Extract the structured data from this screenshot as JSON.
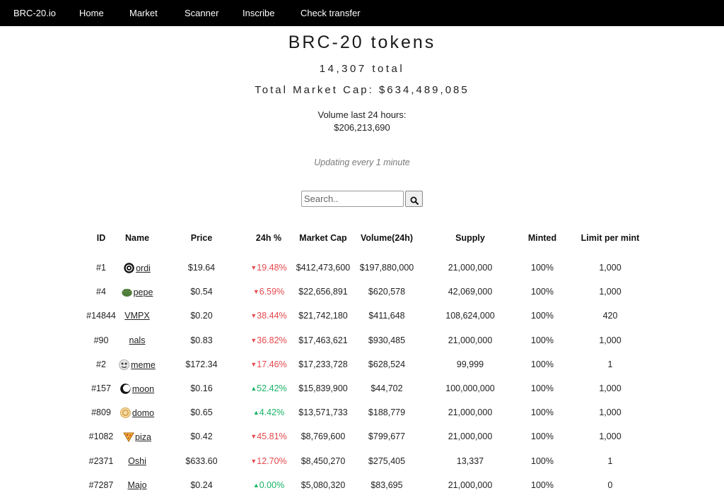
{
  "nav": {
    "brand": "BRC-20.io",
    "items": [
      "Home",
      "Market",
      "Scanner",
      "Inscribe",
      "Check transfer"
    ]
  },
  "header": {
    "title": "BRC-20 tokens",
    "total": "14,307 total",
    "market_cap": "Total Market Cap: $634,489,085",
    "volume_label": "Volume last 24 hours:",
    "volume_value": "$206,213,690",
    "updating": "Updating every 1 minute"
  },
  "search": {
    "placeholder": "Search..",
    "button_icon": "search-icon"
  },
  "colors": {
    "navbar_bg": "#000000",
    "negative": "#e5484d",
    "positive": "#16b364"
  },
  "table": {
    "columns": [
      "ID",
      "Name",
      "Price",
      "24h %",
      "Market Cap",
      "Volume(24h)",
      "Supply",
      "Minted",
      "Limit per mint"
    ],
    "rows": [
      {
        "id": "#1",
        "name": "ordi",
        "icon": "ordi-icon",
        "price": "$19.64",
        "change": "19.48%",
        "dir": "down",
        "mcap": "$412,473,600",
        "volume": "$197,880,000",
        "supply": "21,000,000",
        "minted": "100%",
        "limit": "1,000"
      },
      {
        "id": "#4",
        "name": "pepe",
        "icon": "pepe-icon",
        "price": "$0.54",
        "change": "6.59%",
        "dir": "down",
        "mcap": "$22,656,891",
        "volume": "$620,578",
        "supply": "42,069,000",
        "minted": "100%",
        "limit": "1,000"
      },
      {
        "id": "#14844",
        "name": "VMPX",
        "icon": "",
        "price": "$0.20",
        "change": "38.44%",
        "dir": "down",
        "mcap": "$21,742,180",
        "volume": "$411,648",
        "supply": "108,624,000",
        "minted": "100%",
        "limit": "420"
      },
      {
        "id": "#90",
        "name": "nals",
        "icon": "",
        "price": "$0.83",
        "change": "36.82%",
        "dir": "down",
        "mcap": "$17,463,621",
        "volume": "$930,485",
        "supply": "21,000,000",
        "minted": "100%",
        "limit": "1,000"
      },
      {
        "id": "#2",
        "name": "meme",
        "icon": "meme-icon",
        "price": "$172.34",
        "change": "17.46%",
        "dir": "down",
        "mcap": "$17,233,728",
        "volume": "$628,524",
        "supply": "99,999",
        "minted": "100%",
        "limit": "1"
      },
      {
        "id": "#157",
        "name": "moon",
        "icon": "moon-icon",
        "price": "$0.16",
        "change": "52.42%",
        "dir": "up",
        "mcap": "$15,839,900",
        "volume": "$44,702",
        "supply": "100,000,000",
        "minted": "100%",
        "limit": "1,000"
      },
      {
        "id": "#809",
        "name": "domo",
        "icon": "domo-icon",
        "price": "$0.65",
        "change": "4.42%",
        "dir": "up",
        "mcap": "$13,571,733",
        "volume": "$188,779",
        "supply": "21,000,000",
        "minted": "100%",
        "limit": "1,000"
      },
      {
        "id": "#1082",
        "name": "piza",
        "icon": "pizza-icon",
        "price": "$0.42",
        "change": "45.81%",
        "dir": "down",
        "mcap": "$8,769,600",
        "volume": "$799,677",
        "supply": "21,000,000",
        "minted": "100%",
        "limit": "1,000"
      },
      {
        "id": "#2371",
        "name": "Oshi",
        "icon": "",
        "price": "$633.60",
        "change": "12.70%",
        "dir": "down",
        "mcap": "$8,450,270",
        "volume": "$275,405",
        "supply": "13,337",
        "minted": "100%",
        "limit": "1"
      },
      {
        "id": "#7287",
        "name": "Majo",
        "icon": "",
        "price": "$0.24",
        "change": "0.00%",
        "dir": "up",
        "mcap": "$5,080,320",
        "volume": "$83,695",
        "supply": "21,000,000",
        "minted": "100%",
        "limit": "0"
      }
    ]
  }
}
